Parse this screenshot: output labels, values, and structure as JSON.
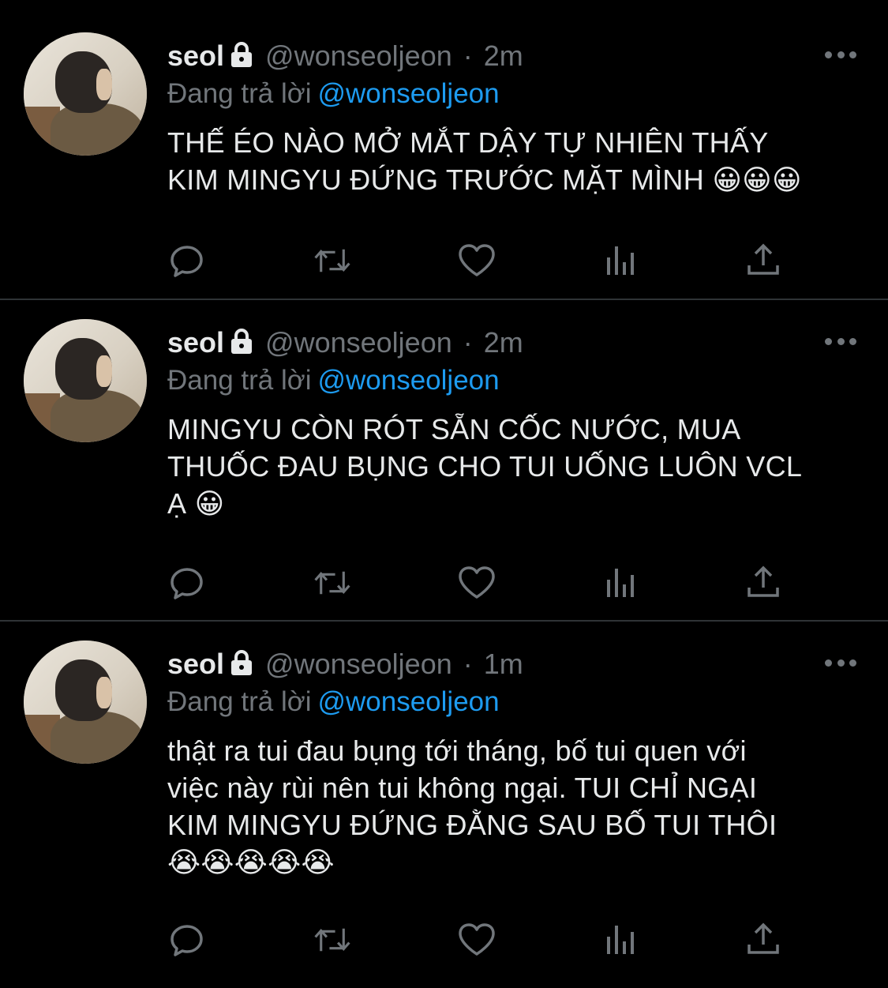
{
  "colors": {
    "background": "#000000",
    "text": "#e7e9ea",
    "muted": "#71767b",
    "accent": "#1d9bf0",
    "divider": "#2f3336"
  },
  "tweets": [
    {
      "name": "seol",
      "handle": "@wonseoljeon",
      "sep": "·",
      "time": "2m",
      "reply_prefix": "Đang trả lời",
      "reply_to": "@wonseoljeon",
      "lines": [
        "THẾ ÉO NÀO MỞ MẮT DẬY TỰ NHIÊN THẤY",
        "KIM MINGYU ĐỨNG TRƯỚC MẶT MÌNH 😀😀😀"
      ]
    },
    {
      "name": "seol",
      "handle": "@wonseoljeon",
      "sep": "·",
      "time": "2m",
      "reply_prefix": "Đang trả lời",
      "reply_to": "@wonseoljeon",
      "lines": [
        "MINGYU CÒN RÓT SẴN CỐC NƯỚC, MUA",
        "THUỐC ĐAU BỤNG CHO TUI UỐNG LUÔN VCL",
        "Ạ 😀"
      ]
    },
    {
      "name": "seol",
      "handle": "@wonseoljeon",
      "sep": "·",
      "time": "1m",
      "reply_prefix": "Đang trả lời",
      "reply_to": "@wonseoljeon",
      "lines": [
        "thật ra tui đau bụng tới tháng, bố tui quen với",
        "việc này rùi nên tui không ngại. TUI CHỈ NGẠI",
        "KIM MINGYU ĐỨNG ĐẰNG SAU BỐ TUI THÔI",
        "😭😭😭😭😭"
      ]
    }
  ],
  "icons": [
    "reply-icon",
    "retweet-icon",
    "like-icon",
    "views-icon",
    "share-icon",
    "more-icon",
    "lock-icon"
  ]
}
